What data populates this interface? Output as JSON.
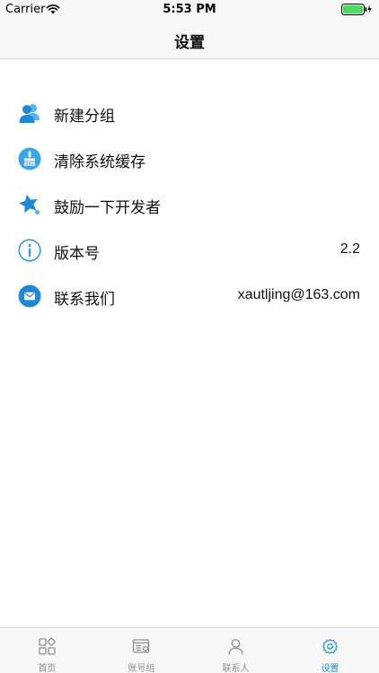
{
  "status_bar": {
    "carrier": "Carrier",
    "time": "5:53 PM",
    "icons": [
      "wifi-icon",
      "battery-icon"
    ]
  },
  "nav_bar": {
    "title": "设置"
  },
  "settings": {
    "items": [
      {
        "label": "新建分组",
        "value": "",
        "icon": "people-icon"
      },
      {
        "label": "清除系统缓存",
        "value": "",
        "icon": "broom-icon"
      },
      {
        "label": "鼓励一下开发者",
        "value": "",
        "icon": "star-icon"
      },
      {
        "label": "版本号",
        "value": "2.2",
        "icon": "info-icon"
      },
      {
        "label": "联系我们",
        "value": "xautljing@163.com",
        "icon": "mail-icon"
      }
    ]
  },
  "tab_bar": {
    "tabs": [
      {
        "label": "首页",
        "icon": "grid-icon",
        "active": false
      },
      {
        "label": "账号组",
        "icon": "account-group-icon",
        "active": false
      },
      {
        "label": "联系人",
        "icon": "person-icon",
        "active": false
      },
      {
        "label": "设置",
        "icon": "gear-icon",
        "active": true
      }
    ]
  },
  "colors": {
    "accent": "#1a8fe6",
    "icon_blue": "#2f9be8",
    "tab_inactive": "#8e8e93",
    "bar_background": "#f7f7f7"
  }
}
